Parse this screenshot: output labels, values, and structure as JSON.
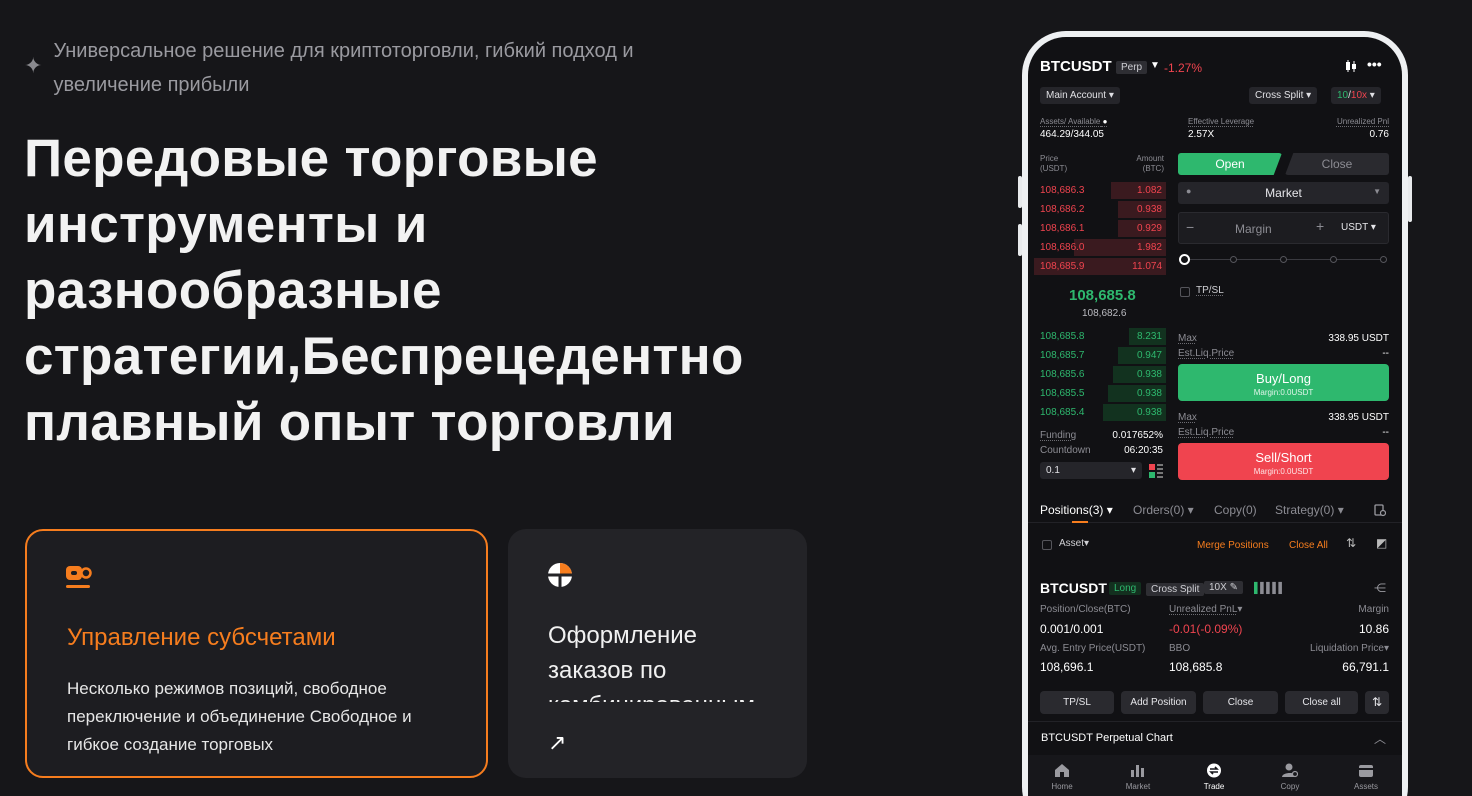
{
  "hero": {
    "tagline": "Универсальное решение для криптоторговли, гибкий подход и увеличение прибыли",
    "title": "Передовые торговые инструменты и разнообразные стратегии,Беспрецедентно плавный опыт торговли"
  },
  "cards": [
    {
      "icon": "subaccount-icon",
      "title": "Управление субсчетами",
      "desc": "Несколько режимов позиций, свободное переключение и объединение Свободное и гибкое создание торговых"
    },
    {
      "icon": "pie-chart-icon",
      "title": "Оформление заказов по комбинированным",
      "arrow": "↗"
    }
  ],
  "app": {
    "symbol": "BTCUSDT",
    "perp_tag": "Perp",
    "change": "-1.27%",
    "account_select": "Main Account",
    "margin_mode_select": "Cross Split",
    "leverage_long": "10",
    "leverage_short": "10x",
    "assets_label": "Assets/ Available",
    "assets_value": "464.29/344.05",
    "eff_leverage_label": "Effective Leverage",
    "eff_leverage_value": "2.57X",
    "unrealized_label": "Unrealized Pnl",
    "unrealized_value": "0.76",
    "book_price_label": "Price",
    "book_price_unit": "(USDT)",
    "book_amount_label": "Amount",
    "book_amount_unit": "(BTC)",
    "asks": [
      {
        "price": "108,686.3",
        "amount": "1.082",
        "depth": 0.42
      },
      {
        "price": "108,686.2",
        "amount": "0.938",
        "depth": 0.36
      },
      {
        "price": "108,686.1",
        "amount": "0.929",
        "depth": 0.36
      },
      {
        "price": "108,686.0",
        "amount": "1.982",
        "depth": 0.7
      },
      {
        "price": "108,685.9",
        "amount": "11.074",
        "depth": 1.0
      }
    ],
    "last_price": "108,685.8",
    "mark_price": "108,682.6",
    "bids": [
      {
        "price": "108,685.8",
        "amount": "8.231",
        "depth": 0.28
      },
      {
        "price": "108,685.7",
        "amount": "0.947",
        "depth": 0.36
      },
      {
        "price": "108,685.6",
        "amount": "0.938",
        "depth": 0.4
      },
      {
        "price": "108,685.5",
        "amount": "0.938",
        "depth": 0.44
      },
      {
        "price": "108,685.4",
        "amount": "0.938",
        "depth": 0.48
      }
    ],
    "funding_label": "Funding",
    "funding_value": "0.017652%",
    "countdown_label": "Countdown",
    "countdown_value": "06:20:35",
    "precision_select": "0.1",
    "tab_open": "Open",
    "tab_close": "Close",
    "order_type": "Market",
    "margin_placeholder": "Margin",
    "margin_unit": "USDT",
    "tpsl_label": "TP/SL",
    "max_label": "Max",
    "max_value": "338.95 USDT",
    "liq_label": "Est.Liq.Price",
    "liq_value": "--",
    "buy_label": "Buy/Long",
    "buy_sub": "Margin:0.0USDT",
    "sell_label": "Sell/Short",
    "sell_sub": "Margin:0.0USDT",
    "ptabs": [
      "Positions(3)",
      "Orders(0)",
      "Copy(0)",
      "Strategy(0)"
    ],
    "asset_filter": "Asset",
    "merge_positions": "Merge Positions",
    "close_all": "Close All",
    "position": {
      "symbol": "BTCUSDT",
      "side": "Long",
      "mode": "Cross Split",
      "leverage": "10X",
      "pos_close_label": "Position/Close(BTC)",
      "pos_close_value": "0.001/0.001",
      "upnl_label": "Unrealized PnL",
      "upnl_value": "-0.01(-0.09%)",
      "margin_label": "Margin",
      "margin_value": "10.86",
      "entry_label": "Avg. Entry Price(USDT)",
      "entry_value": "108,696.1",
      "bbo_label": "BBO",
      "bbo_value": "108,685.8",
      "liq_label": "Liquidation Price",
      "liq_value": "66,791.1"
    },
    "pos_buttons": [
      "TP/SL",
      "Add Position",
      "Close",
      "Close all"
    ],
    "chart_section": "BTCUSDT Perpetual Chart",
    "nav": [
      "Home",
      "Market",
      "Trade",
      "Copy",
      "Assets"
    ]
  },
  "colors": {
    "accent": "#f67d1e",
    "buy": "#2eb86e",
    "sell": "#f0444f",
    "background": "#161619"
  }
}
